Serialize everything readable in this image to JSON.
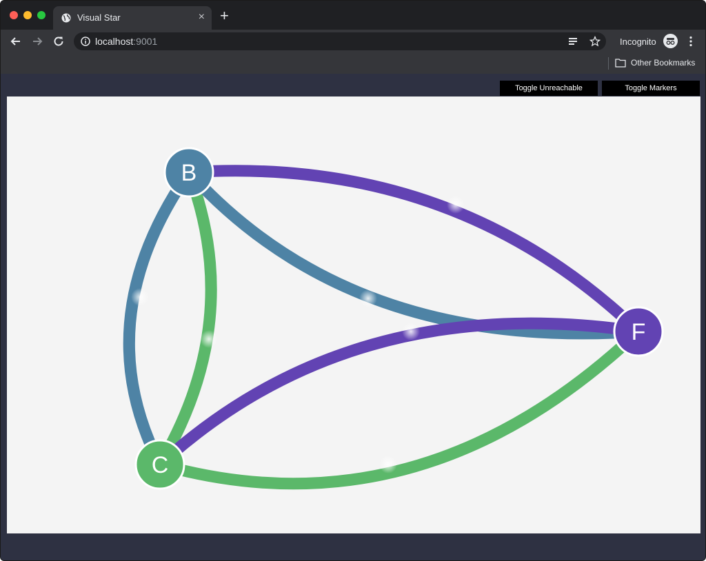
{
  "browser": {
    "tab_title": "Visual Star",
    "tab_close": "×",
    "new_tab": "+",
    "url_host": "localhost",
    "url_port": ":9001",
    "profile_label": "Incognito",
    "bookmark_folder": "Other Bookmarks"
  },
  "controls": {
    "toggle_unreachable": "Toggle Unreachable",
    "toggle_markers": "Toggle Markers"
  },
  "graph": {
    "nodes": [
      {
        "id": "B",
        "label": "B",
        "color": "#4e83a5"
      },
      {
        "id": "C",
        "label": "C",
        "color": "#5bb86a"
      },
      {
        "id": "F",
        "label": "F",
        "color": "#6243b3"
      }
    ],
    "edges": [
      {
        "from": "B",
        "to": "F",
        "color": "#6243b3"
      },
      {
        "from": "B",
        "to": "F",
        "color": "#4e83a5"
      },
      {
        "from": "B",
        "to": "C",
        "color": "#4e83a5"
      },
      {
        "from": "B",
        "to": "C",
        "color": "#5bb86a"
      },
      {
        "from": "C",
        "to": "F",
        "color": "#6243b3"
      },
      {
        "from": "C",
        "to": "F",
        "color": "#5bb86a"
      }
    ]
  }
}
